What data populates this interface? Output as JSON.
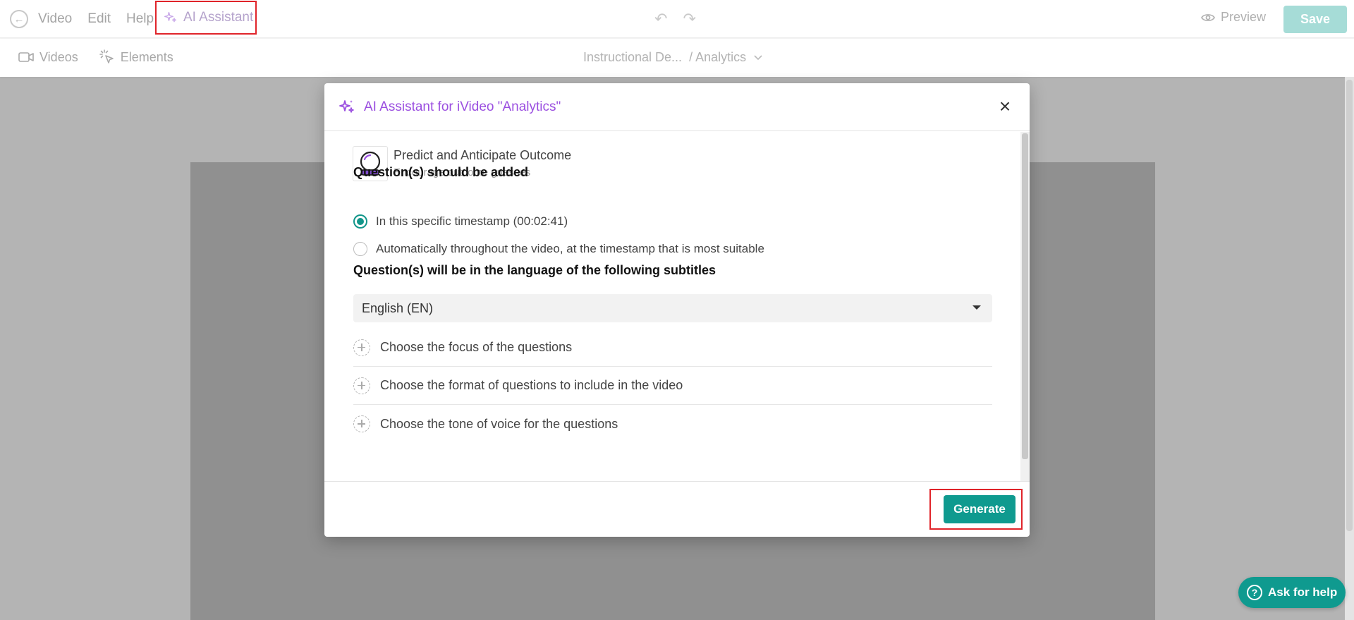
{
  "topbar": {
    "menu": [
      "Video",
      "Edit",
      "Help"
    ],
    "ai_assistant_label": "AI Assistant",
    "preview_label": "Preview",
    "save_label": "Save"
  },
  "subbar": {
    "tabs": [
      "Videos",
      "Elements"
    ],
    "breadcrumb_parent": "Instructional De...",
    "breadcrumb_current": "/ Analytics"
  },
  "modal": {
    "title": "AI Assistant for iVideo \"Analytics\"",
    "strategy": {
      "name": "Predict and Anticipate Outcome",
      "description": "Encourage outcome guesses"
    },
    "placement_title": "Question(s) should be added",
    "placement_options": [
      {
        "label": "In this specific timestamp (00:02:41)",
        "checked": true
      },
      {
        "label": "Automatically throughout the video, at the timestamp that is most suitable",
        "checked": false
      }
    ],
    "language_title": "Question(s) will be in the language of the following subtitles",
    "language_selected": "English (EN)",
    "options": [
      "Choose the focus of the questions",
      "Choose the format of questions to include in the video",
      "Choose the tone of voice for the questions"
    ],
    "generate_label": "Generate"
  },
  "help_label": "Ask for help",
  "colors": {
    "accent": "#0f9a8f",
    "ai_purple": "#9b4fe0",
    "highlight": "#e0242a"
  }
}
